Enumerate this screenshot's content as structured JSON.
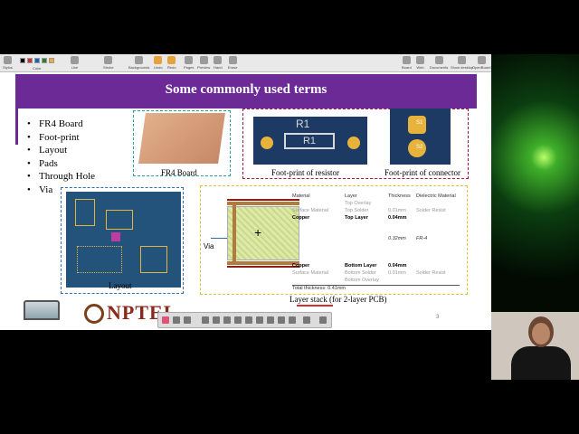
{
  "toolbar": {
    "items": [
      "Stylus",
      "Color",
      "Line",
      "Stroke",
      "Backgrounds",
      "Undo",
      "Redo",
      "Pages",
      "Preview",
      "Hand",
      "Erase",
      "Board",
      "Web",
      "Documents",
      "Show desktop",
      "OpenBoard"
    ],
    "colors": [
      "#000000",
      "#d32f2f",
      "#1565c0",
      "#2e7d32",
      "#f9a825"
    ]
  },
  "slide": {
    "title": "Some commonly used terms",
    "bullets": [
      "FR4 Board",
      "Foot-print",
      "Layout",
      "Pads",
      "Through Hole",
      "Via"
    ],
    "captions": {
      "fr4": "FR4 Board",
      "resistor": "Foot-print of resistor",
      "connector": "Foot-print of connector",
      "layout": "Layout",
      "layer_stack": "Layer stack (for 2-layer PCB)"
    },
    "resistor_labels": [
      "R1",
      "R1"
    ],
    "connector_labels": [
      "S1",
      "S2"
    ],
    "via_label": "Via",
    "stack_headers": [
      "Material",
      "Layer",
      "Thickness",
      "Dielectric Material"
    ],
    "stack_rows": [
      [
        "",
        "Top Overlay",
        "",
        ""
      ],
      [
        "Surface Material",
        "Top Solder",
        "0.01mm",
        "Solder Resist"
      ],
      [
        "Copper",
        "Top Layer",
        "0.04mm",
        ""
      ],
      [
        "",
        "",
        "0.32mm",
        "FR-4"
      ],
      [
        "Copper",
        "Bottom Layer",
        "0.04mm",
        ""
      ],
      [
        "Surface Material",
        "Bottom Solder",
        "0.01mm",
        "Solder Resist"
      ],
      [
        "",
        "Bottom Overlay",
        "",
        ""
      ]
    ],
    "total_thickness": "Total thickness: 0.41mm",
    "page_number": "3",
    "logo_text": "NPTEL"
  }
}
